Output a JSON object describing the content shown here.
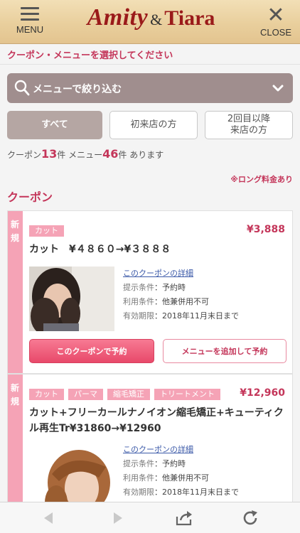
{
  "header": {
    "menu_label": "MENU",
    "logo_word1": "Amity",
    "logo_amp": "&",
    "logo_word2": "Tiara",
    "close_label": "CLOSE"
  },
  "prompt": "クーポン・メニューを選択してください",
  "filter": {
    "label": "メニューで絞り込む",
    "icon": "search-icon"
  },
  "tabs": [
    {
      "label": "すべて",
      "active": true
    },
    {
      "label": "初来店の方"
    },
    {
      "label_line1": "2回目以降",
      "label_line2": "来店の方"
    }
  ],
  "counts": {
    "coupon_label": "クーポン",
    "coupon_count": "13",
    "coupon_unit": "件",
    "menu_label": "メニュー",
    "menu_count": "46",
    "menu_unit": "件",
    "suffix": "あります"
  },
  "long_note": "※ロング料金あり",
  "section_title": "クーポン",
  "coupons": [
    {
      "badge": "新規",
      "tags": [
        "カット"
      ],
      "price": "¥3,888",
      "title": "カット　¥４８６０→¥３８８８",
      "detail_link": "このクーポンの詳細",
      "rows": [
        {
          "label": "提示条件",
          "value": "予約時"
        },
        {
          "label": "利用条件",
          "value": "他兼併用不可"
        },
        {
          "label": "有効期限",
          "value": "2018年11月末日まで"
        }
      ],
      "reserve_label": "このクーポンで予約",
      "add_label": "メニューを追加して予約"
    },
    {
      "badge": "新規",
      "tags": [
        "カット",
        "パーマ",
        "縮毛矯正",
        "トリートメント"
      ],
      "price": "¥12,960",
      "title": "カット+フリーカールナノイオン縮毛矯正+キューティクル再生Tr¥31860→¥12960",
      "detail_link": "このクーポンの詳細",
      "rows": [
        {
          "label": "提示条件",
          "value": "予約時"
        },
        {
          "label": "利用条件",
          "value": "他兼併用不可"
        },
        {
          "label": "有効期限",
          "value": "2018年11月末日まで"
        }
      ]
    }
  ],
  "colors": {
    "accent": "#c4365a",
    "tag": "#f5a3b6",
    "filter_bg": "#a08e8e"
  }
}
